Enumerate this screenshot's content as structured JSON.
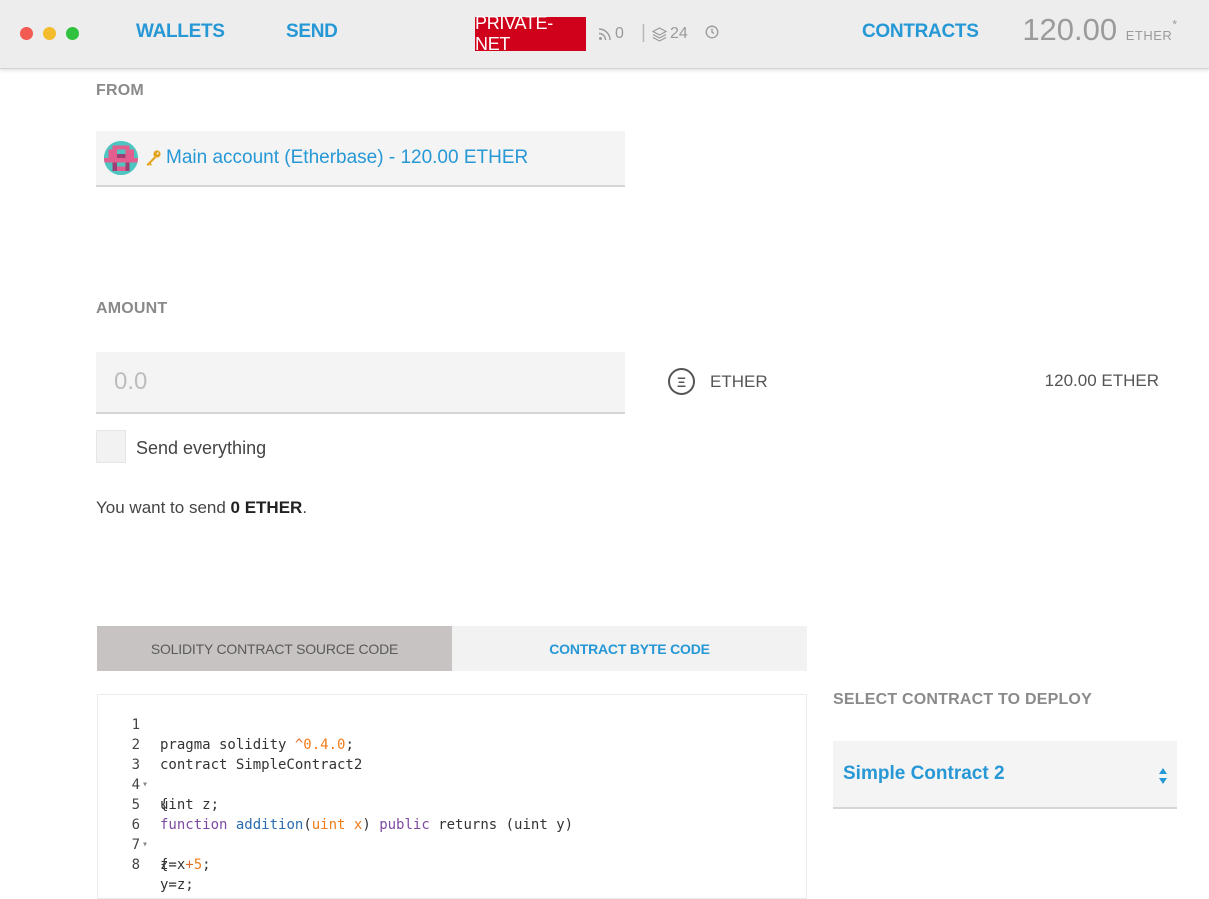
{
  "header": {
    "nav": {
      "wallets": "WALLETS",
      "send": "SEND",
      "contracts": "CONTRACTS"
    },
    "network_badge": "PRIVATE-NET",
    "peers": "0",
    "separator": "|",
    "blocks": "24",
    "balance": {
      "amount": "120.00",
      "unit": "ETHER",
      "mark": "*"
    }
  },
  "form": {
    "from": {
      "label": "FROM",
      "account": "Main account (Etherbase) - 120.00 ETHER"
    },
    "amount": {
      "label": "AMOUNT",
      "placeholder": "0.0",
      "unit": "ETHER",
      "unit_symbol": "Ξ",
      "available": "120.00 ETHER"
    },
    "send_everything": {
      "label": "Send everything",
      "checked": false
    },
    "summary": {
      "prefix": "You want to send ",
      "amount": "0 ETHER",
      "suffix": "."
    }
  },
  "tabs": {
    "source": "SOLIDITY CONTRACT SOURCE CODE",
    "bytecode": "CONTRACT BYTE CODE",
    "active": "source"
  },
  "code": {
    "lines": [
      {
        "n": "1",
        "text": "pragma solidity ^0.4.0;"
      },
      {
        "n": "2",
        "text": "contract SimpleContract2"
      },
      {
        "n": "3",
        "text": "{"
      },
      {
        "n": "4",
        "text": "uint z;"
      },
      {
        "n": "5",
        "text": "function addition(uint x) public returns (uint y)"
      },
      {
        "n": "6",
        "text": "{"
      },
      {
        "n": "7",
        "text": "z=x+5;"
      },
      {
        "n": "8",
        "text": "y=z;"
      }
    ]
  },
  "deploy": {
    "label": "SELECT CONTRACT TO DEPLOY",
    "selected": "Simple Contract 2"
  },
  "colors": {
    "accent": "#2698d6",
    "network_badge": "#d0021b"
  }
}
